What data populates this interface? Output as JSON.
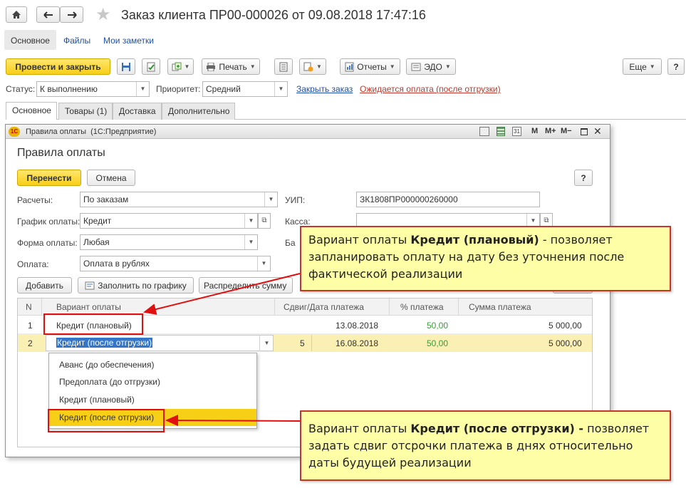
{
  "window": {
    "title": "Заказ клиента ПР00-000026 от 09.08.2018 17:47:16",
    "star": "★"
  },
  "nav_tabs": [
    "Основное",
    "Файлы",
    "Мои заметки"
  ],
  "toolbar": {
    "post_close": "Провести и закрыть",
    "print": "Печать",
    "reports": "Отчеты",
    "edo": "ЭДО",
    "more": "Еще",
    "help": "?"
  },
  "status_row": {
    "status_label": "Статус:",
    "status_value": "К выполнению",
    "priority_label": "Приоритет:",
    "priority_value": "Средний",
    "close_order_link": "Закрыть заказ",
    "awaiting_link": "Ожидается оплата (после отгрузки)"
  },
  "content_tabs": [
    "Основное",
    "Товары (1)",
    "Доставка",
    "Дополнительно"
  ],
  "dialog": {
    "caption": "Правила оплаты  (1С:Предприятие)",
    "caption_buttons": [
      "M",
      "M+",
      "M−"
    ],
    "heading": "Правила оплаты",
    "transfer_btn": "Перенести",
    "cancel_btn": "Отмена",
    "help": "?",
    "settlements_label": "Расчеты:",
    "settlements_value": "По заказам",
    "uip_label": "УИП:",
    "uip_value": "ЗК1808ПР000000260000",
    "schedule_label": "График оплаты:",
    "schedule_value": "Кредит",
    "cash_label": "Касса:",
    "cash_value": "",
    "form_label": "Форма оплаты:",
    "form_value": "Любая",
    "bank_label": "Ба",
    "payment_label": "Оплата:",
    "payment_value": "Оплата в рублях",
    "add_btn": "Добавить",
    "fill_btn": "Заполнить по графику",
    "distribute_btn": "Распределить сумму"
  },
  "grid": {
    "headers": [
      "N",
      "Вариант оплаты",
      "Сдвиг/Дата платежа",
      "% платежа",
      "Сумма платежа"
    ],
    "rows": [
      {
        "n": "1",
        "variant": "Кредит (плановый)",
        "shift": "",
        "date": "13.08.2018",
        "percent": "50,00",
        "sum": "5 000,00"
      },
      {
        "n": "2",
        "variant": "Кредит (после отгрузки)",
        "shift": "5",
        "date": "16.08.2018",
        "percent": "50,00",
        "sum": "5 000,00"
      }
    ]
  },
  "dropdown": {
    "options": [
      "Аванс (до обеспечения)",
      "Предоплата (до отгрузки)",
      "Кредит (плановый)",
      "Кредит (после отгрузки)"
    ],
    "selected_index": 3
  },
  "callouts": {
    "top": {
      "pre": "Вариант оплаты ",
      "bold": "Кредит (плановый)",
      "post": " - позволяет запланировать оплату на дату без уточнения после фактической реализации"
    },
    "bottom": {
      "pre": "Вариант оплаты ",
      "bold": "Кредит (после отгрузки) -",
      "post": " позволяет задать сдвиг отсрочки платежа в днях относительно даты будущей реализации"
    }
  },
  "colors": {
    "accent_yellow": "#f7cf17",
    "link_blue": "#1f4fa8",
    "link_red": "#c0392b",
    "highlight_row": "#fbf0b4",
    "percent_green": "#3a9a3a",
    "callout_bg": "#fefea6",
    "red_frame": "#e01010"
  }
}
